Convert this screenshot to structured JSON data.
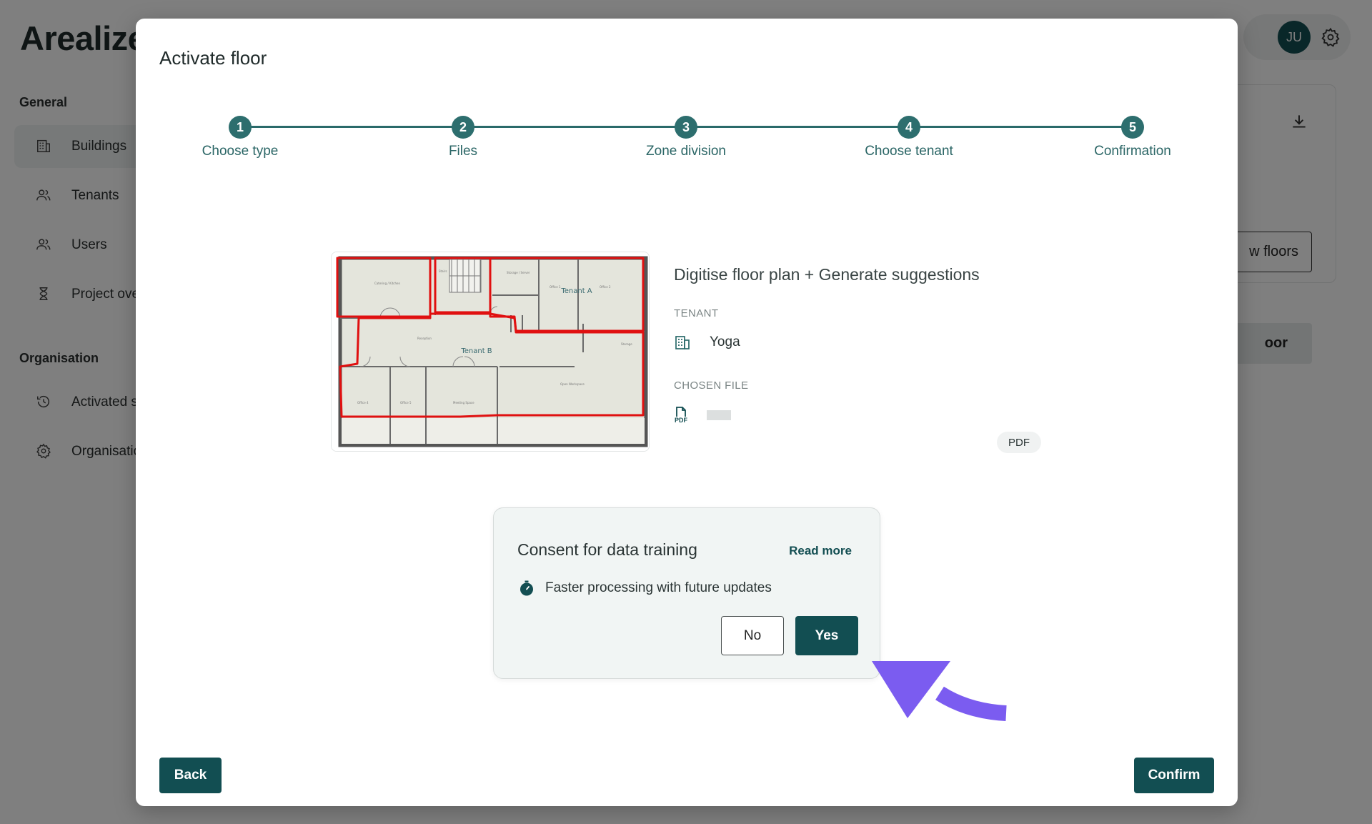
{
  "app": {
    "logo": "Arealize",
    "nav": {
      "general_title": "General",
      "items": [
        {
          "label": "Buildings",
          "icon": "building-icon"
        },
        {
          "label": "Tenants",
          "icon": "users-icon"
        },
        {
          "label": "Users",
          "icon": "users-icon"
        },
        {
          "label": "Project ove",
          "icon": "hourglass-icon"
        }
      ],
      "organisation_title": "Organisation",
      "org_items": [
        {
          "label": "Activated s",
          "icon": "history-icon"
        },
        {
          "label": "Organisatio",
          "icon": "gear-icon"
        }
      ]
    },
    "avatar_initials": "JU",
    "bg_button_1": "w floors",
    "bg_button_2": "oor"
  },
  "modal": {
    "title": "Activate floor",
    "steps": [
      {
        "number": "1",
        "label": "Choose type"
      },
      {
        "number": "2",
        "label": "Files"
      },
      {
        "number": "3",
        "label": "Zone division"
      },
      {
        "number": "4",
        "label": "Choose tenant"
      },
      {
        "number": "5",
        "label": "Confirmation"
      }
    ],
    "floorplan": {
      "zone_a": "Tenant A",
      "zone_b": "Tenant B"
    },
    "info": {
      "title": "Digitise floor plan + Generate suggestions",
      "tenant_label": "TENANT",
      "tenant_value": "Yoga",
      "file_label": "CHOSEN FILE",
      "file_badge": "PDF",
      "file_icon_text": "PDF"
    },
    "consent": {
      "title": "Consent for data training",
      "read_more": "Read more",
      "benefit": "Faster processing with future updates",
      "no_label": "No",
      "yes_label": "Yes"
    },
    "back_label": "Back",
    "confirm_label": "Confirm"
  },
  "colors": {
    "primary": "#124e52",
    "step": "#2d6e6e",
    "zone_outline": "#e01010",
    "arrow": "#7b5cf0"
  }
}
